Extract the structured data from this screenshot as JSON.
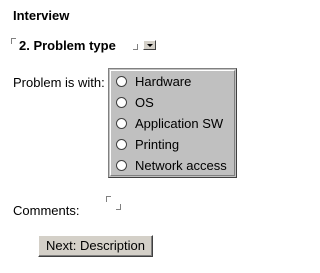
{
  "page_title": "Interview",
  "section": {
    "heading": "2. Problem type",
    "dropdown_icon": "dropdown-arrow-icon"
  },
  "problem": {
    "label": "Problem is with:",
    "options": [
      {
        "label": "Hardware",
        "selected": false
      },
      {
        "label": "OS",
        "selected": false
      },
      {
        "label": "Application SW",
        "selected": false
      },
      {
        "label": "Printing",
        "selected": false
      },
      {
        "label": "Network access",
        "selected": false
      }
    ]
  },
  "comments": {
    "label": "Comments:",
    "value": ""
  },
  "next_button": {
    "label": "Next: Description"
  },
  "colors": {
    "panel_background": "#c0c0c0",
    "button_face": "#d4d0c8",
    "page_background": "#ffffff"
  }
}
